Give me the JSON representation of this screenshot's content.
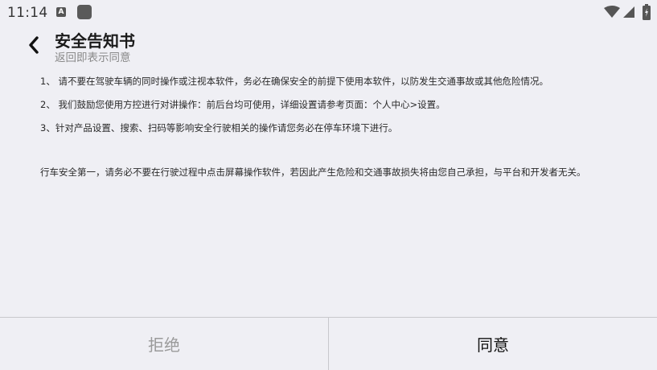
{
  "status_bar": {
    "time": "11:14",
    "notification_badge": "A"
  },
  "header": {
    "title": "安全告知书",
    "subtitle": "返回即表示同意"
  },
  "notices": [
    "1、 请不要在驾驶车辆的同时操作或注视本软件，务必在确保安全的前提下使用本软件，以防发生交通事故或其他危险情况。",
    "2、 我们鼓励您使用方控进行对讲操作：前后台均可使用，详细设置请参考页面：个人中心>设置。",
    "3、针对产品设置、搜索、扫码等影响安全行驶相关的操作请您务必在停车环境下进行。"
  ],
  "warning": "行车安全第一，请务必不要在行驶过程中点击屏幕操作软件，若因此产生危险和交通事故损失将由您自己承担，与平台和开发者无关。",
  "footer": {
    "reject_label": "拒绝",
    "agree_label": "同意"
  },
  "colors": {
    "background": "#efeff4",
    "divider": "#c8c8cc",
    "reject_text": "#9a9a9a",
    "agree_text": "#111111"
  }
}
